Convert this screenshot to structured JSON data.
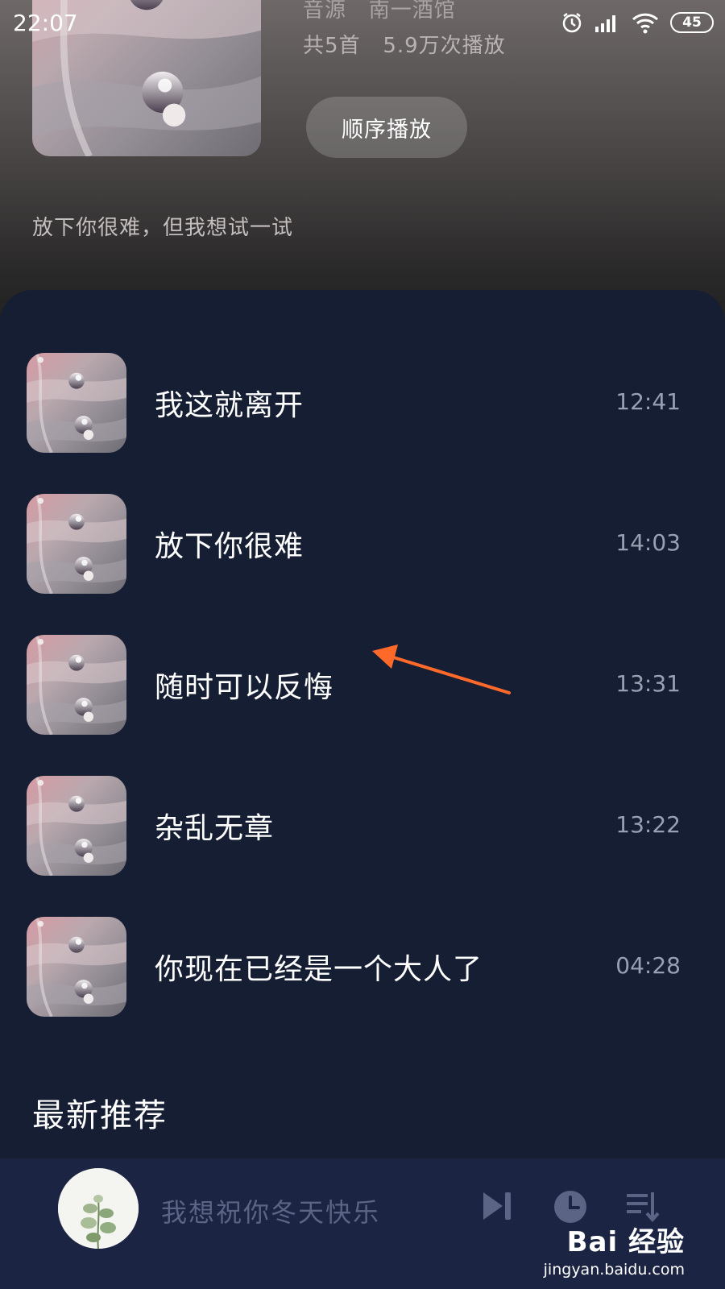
{
  "status_bar": {
    "time": "22:07",
    "battery": "45",
    "icons": [
      "alarm-icon",
      "signal-icon",
      "wifi-icon",
      "battery-icon"
    ]
  },
  "album": {
    "source": "音源   南一酒馆",
    "stats": "共5首   5.9万次播放",
    "play_button": "顺序播放",
    "description": "放下你很难，但我想试一试"
  },
  "tracks": [
    {
      "title": "我这就离开",
      "duration": "12:41"
    },
    {
      "title": "放下你很难",
      "duration": "14:03"
    },
    {
      "title": "随时可以反悔",
      "duration": "13:31"
    },
    {
      "title": "杂乱无章",
      "duration": "13:22"
    },
    {
      "title": "你现在已经是一个大人了",
      "duration": "04:28"
    }
  ],
  "section": {
    "title": "最新推荐"
  },
  "player": {
    "title": "我想祝你冬天快乐",
    "icons": [
      "skip-next-icon",
      "timer-icon",
      "playlist-icon"
    ]
  },
  "watermark": {
    "brand": "Bai 经验",
    "url": "jingyan.baidu.com"
  },
  "colors": {
    "panel_bg": "#161e33",
    "player_bg": "#1c2443",
    "arrow": "#ff6a2b",
    "player_icon": "#5b6485"
  }
}
